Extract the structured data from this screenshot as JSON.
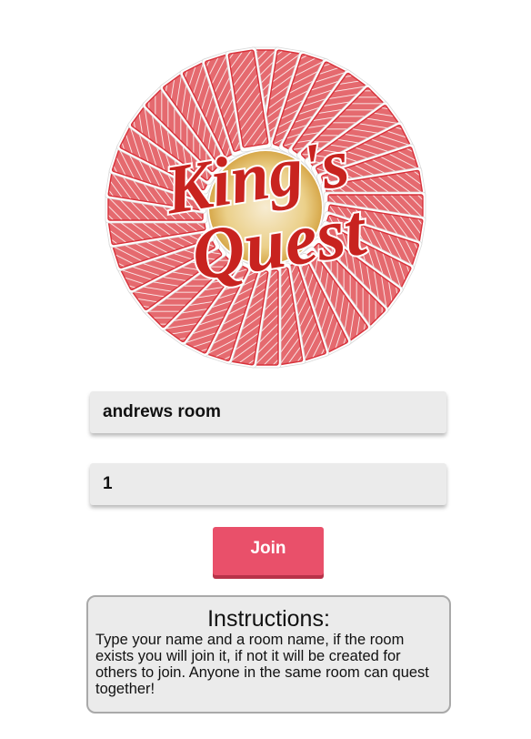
{
  "logo": {
    "line1": "King's",
    "line2": "Quest",
    "card_back_color": "#d8313a",
    "title_color": "#c8231f"
  },
  "form": {
    "room_value": "andrews room",
    "name_value": "1",
    "join_label": "Join",
    "join_color": "#e9506a"
  },
  "instructions": {
    "title": "Instructions:",
    "body": "Type your name and a room name, if the room exists you will join it, if not it will be created for others to join. Anyone in the same room can quest together!"
  }
}
